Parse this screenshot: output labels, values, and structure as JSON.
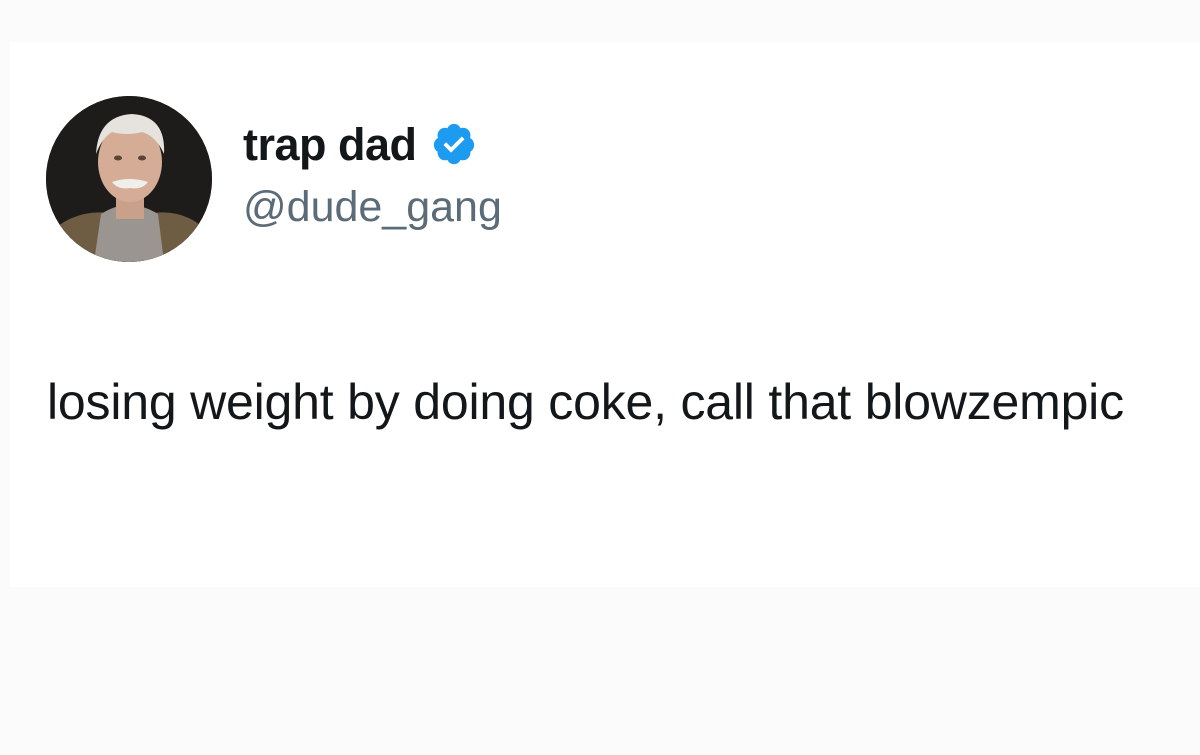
{
  "tweet": {
    "author": {
      "display_name": "trap dad",
      "handle": "@dude_gang",
      "verified": true,
      "avatar_icon": "profile-photo"
    },
    "text": "losing weight by doing coke, call that blowzempic"
  },
  "colors": {
    "verified_badge": "#1d9bf0",
    "handle": "#5b6b78",
    "text": "#14171a",
    "background": "#ffffff"
  }
}
